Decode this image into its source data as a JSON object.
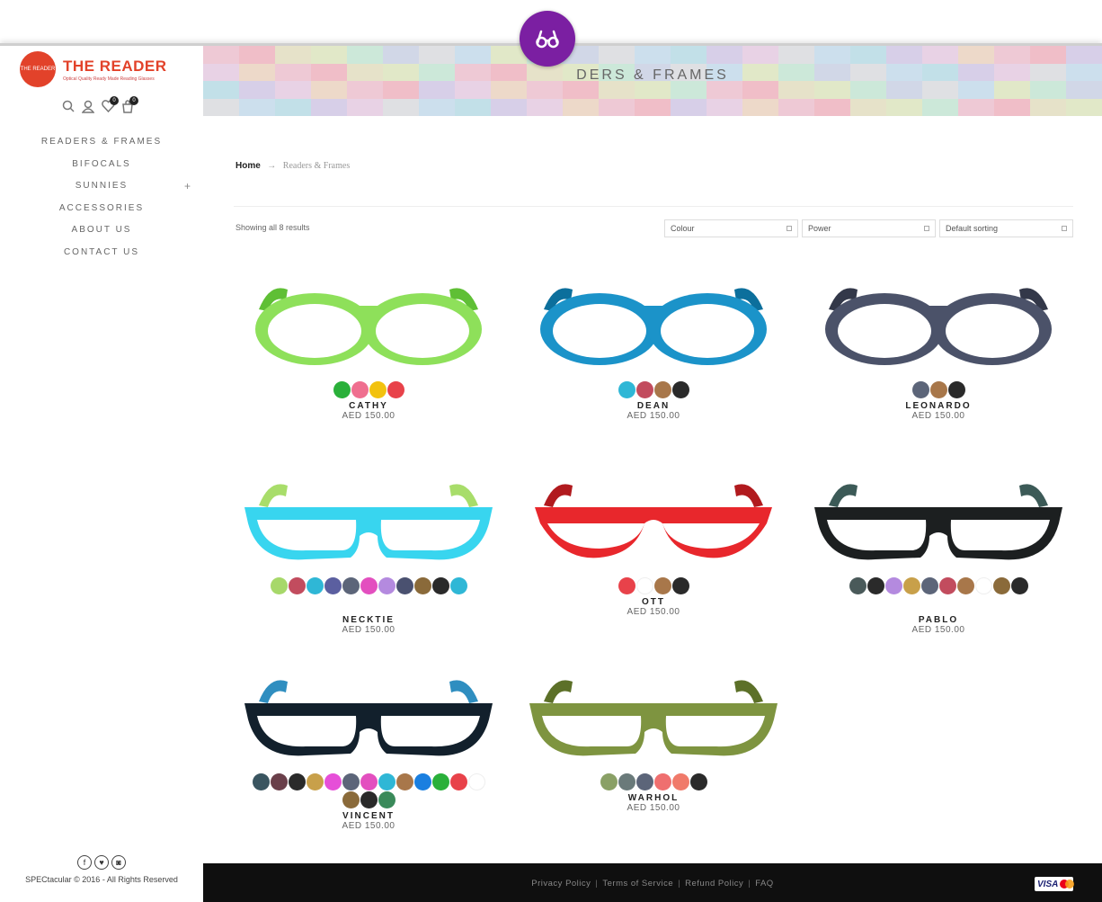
{
  "brand": {
    "logo_text": "THE READER",
    "circle_text": "THE READER",
    "tagline": "Optical Quality Ready Made Reading Glasses",
    "color": "#e2422a"
  },
  "header_icons": {
    "wishlist_count": "0",
    "cart_count": "0"
  },
  "nav": {
    "items": [
      {
        "label": "READERS & FRAMES"
      },
      {
        "label": "BIFOCALS"
      },
      {
        "label": "SUNNIES",
        "plus": "+"
      },
      {
        "label": "ACCESSORIES"
      },
      {
        "label": "ABOUT US"
      },
      {
        "label": "CONTACT US"
      }
    ]
  },
  "banner": {
    "title": "DERS & FRAMES"
  },
  "breadcrumb": {
    "home": "Home",
    "sep": "→",
    "current": "Readers & Frames"
  },
  "results": {
    "text": "Showing all 8 results"
  },
  "filters": {
    "colour": "Colour",
    "power": "Power",
    "sorting": "Default sorting"
  },
  "products": [
    {
      "name": "CATHY",
      "price": "AED 150.00",
      "frame_color": "#8ee05a",
      "frame_dark": "#5fbf35",
      "swatches": [
        "#2ab03a",
        "#ef6f8f",
        "#f2c20f",
        "#e8424a"
      ]
    },
    {
      "name": "DEAN",
      "price": "AED 150.00",
      "frame_color": "#1b93c9",
      "frame_dark": "#0c6f9c",
      "swatches": [
        "#2fb7d6",
        "#c24c5e",
        "#a8774a",
        "#2a2a2a"
      ]
    },
    {
      "name": "LEONARDO",
      "price": "AED 150.00",
      "frame_color": "#4b5269",
      "frame_dark": "#333849",
      "swatches": [
        "#5c6579",
        "#a8774a",
        "#2a2a2a"
      ]
    },
    {
      "name": "NECKTIE",
      "price": "AED 150.00",
      "frame_color": "#38d5ef",
      "frame_dark": "#a8dd6a",
      "swatches": [
        "#a7d86a",
        "#c24c5e",
        "#2fb7d6",
        "#5b5fa0",
        "#5c6579",
        "#e34fbf",
        "#b48adf",
        "#4a5170",
        "#8a6a3a",
        "#2a2a2a",
        "#2fb7d6"
      ]
    },
    {
      "name": "OTT",
      "price": "AED 150.00",
      "frame_color": "#e8272c",
      "frame_dark": "#b11a1e",
      "swatches": [
        "#e8424a",
        "#ffffff",
        "#a8774a",
        "#2a2a2a"
      ]
    },
    {
      "name": "PABLO",
      "price": "AED 150.00",
      "frame_color": "#1c1f20",
      "frame_dark": "#3c5a57",
      "swatches": [
        "#4a5a5a",
        "#2a2a2a",
        "#b48adf",
        "#c8a04a",
        "#5c6579",
        "#c24c5e",
        "#a8774a",
        "#ffffff",
        "#8a6a3a",
        "#2a2a2a"
      ]
    },
    {
      "name": "VINCENT",
      "price": "AED 150.00",
      "frame_color": "#12202c",
      "frame_dark": "#2f8ec0",
      "swatches": [
        "#3a5560",
        "#6a3f4a",
        "#2a2a2a",
        "#c8a04a",
        "#e64fd8",
        "#5c6579",
        "#e34fbf",
        "#2fb7d6",
        "#a8774a",
        "#1a7fe0",
        "#2ab03a",
        "#e8424a",
        "#ffffff",
        "#8a6a3a",
        "#2a2a2a",
        "#3a8a5a"
      ]
    },
    {
      "name": "WARHOL",
      "price": "AED 150.00",
      "frame_color": "#7e9440",
      "frame_dark": "#5c7028",
      "swatches": [
        "#8aa066",
        "#6a7a7a",
        "#5c6579",
        "#ef6f6f",
        "#f07a6a",
        "#2a2a2a"
      ]
    }
  ],
  "footer": {
    "links": [
      "Privacy Policy",
      "Terms of Service",
      "Refund Policy",
      "FAQ"
    ],
    "separator": "|",
    "copyright": "SPECtacular © 2016 - All Rights Reserved",
    "visa": "VISA"
  },
  "colors": {
    "accent_purple": "#7b1fa2",
    "footer_bg": "#0f0f0f"
  }
}
